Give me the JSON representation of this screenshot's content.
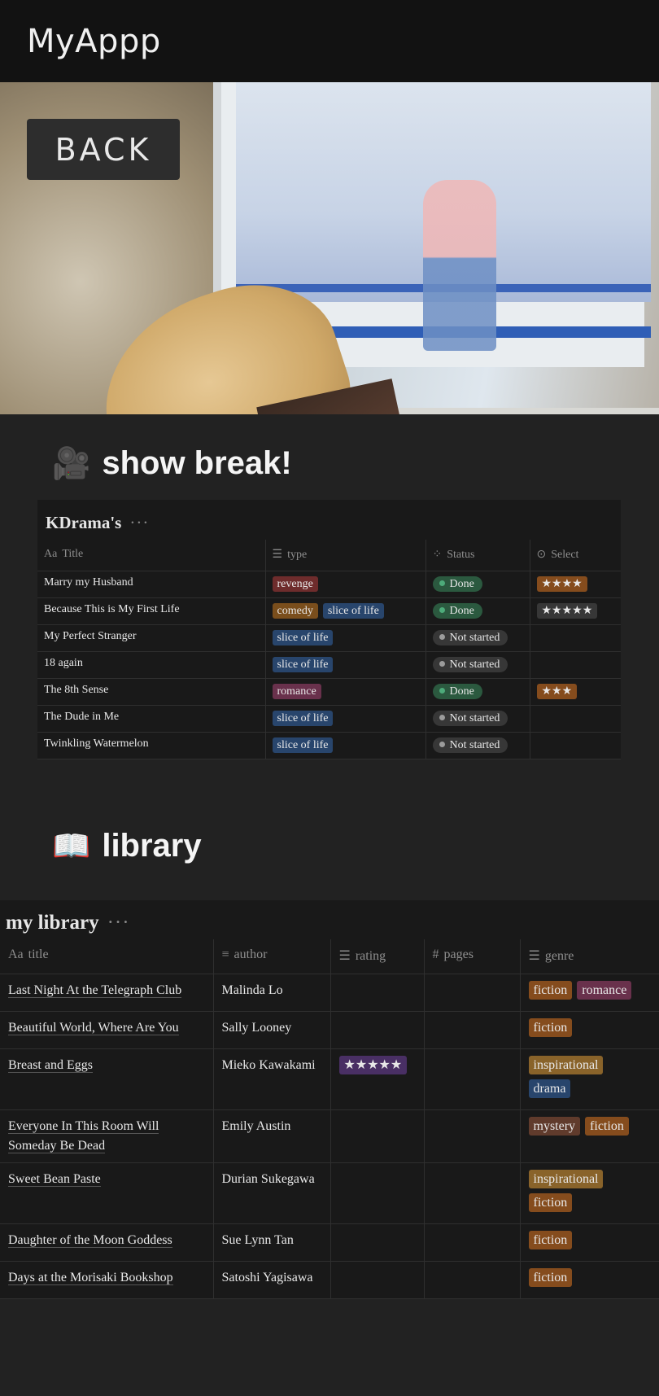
{
  "app": {
    "title": "MyAppp"
  },
  "cover": {
    "back_label": "BACK",
    "page_icon": "jellyfish-icon"
  },
  "kdrama": {
    "heading_emoji": "🎥",
    "heading": "show break!",
    "db_title": "KDrama's",
    "more": "···",
    "columns": {
      "title": "Title",
      "type": "type",
      "status": "Status",
      "select": "Select"
    },
    "column_icons": {
      "title": "Aa",
      "type": "☰",
      "status": "⁘",
      "select": "⊙"
    },
    "rows": [
      {
        "title": "Marry my Husband",
        "types": [
          {
            "label": "revenge",
            "color": "#6e2c2c"
          }
        ],
        "status": "Done",
        "select": "★★★★"
      },
      {
        "title": "Because This is My First Life",
        "types": [
          {
            "label": "comedy",
            "color": "#7a4e1c"
          },
          {
            "label": "slice of life",
            "color": "#28456c"
          }
        ],
        "status": "Done",
        "select": "★★★★★"
      },
      {
        "title": "My Perfect Stranger",
        "types": [
          {
            "label": "slice of life",
            "color": "#28456c"
          }
        ],
        "status": "Not started",
        "select": ""
      },
      {
        "title": "18 again",
        "types": [
          {
            "label": "slice of life",
            "color": "#28456c"
          }
        ],
        "status": "Not started",
        "select": ""
      },
      {
        "title": "The 8th Sense",
        "types": [
          {
            "label": "romance",
            "color": "#69314c"
          }
        ],
        "status": "Done",
        "select": "★★★"
      },
      {
        "title": "The Dude in Me",
        "types": [
          {
            "label": "slice of life",
            "color": "#28456c"
          }
        ],
        "status": "Not started",
        "select": ""
      },
      {
        "title": "Twinkling Watermelon",
        "types": [
          {
            "label": "slice of life",
            "color": "#28456c"
          }
        ],
        "status": "Not started",
        "select": ""
      }
    ],
    "status_colors": {
      "Done": "#2b593f",
      "Not started": "#373737"
    },
    "status_dot_colors": {
      "Done": "#4dab7a",
      "Not started": "#9b9b9b"
    },
    "select_colors": {
      "★★★★": "#854c1d",
      "★★★★★": "#373737",
      "★★★": "#854c1d"
    }
  },
  "library": {
    "heading_emoji": "📖",
    "heading": "library",
    "db_title": "my library",
    "more": "···",
    "columns": {
      "title": "title",
      "author": "author",
      "rating": "rating",
      "pages": "pages",
      "genre": "genre"
    },
    "column_icons": {
      "title": "Aa",
      "author": "≡",
      "rating": "☰",
      "pages": "#",
      "genre": "☰"
    },
    "rows": [
      {
        "title": "Last Night At the Telegraph Club",
        "author": "Malinda Lo",
        "rating": "",
        "pages": "",
        "genres": [
          {
            "label": "fiction",
            "color": "#854c1d"
          },
          {
            "label": "romance",
            "color": "#69314c"
          }
        ]
      },
      {
        "title": "Beautiful World, Where Are You",
        "author": "Sally Looney",
        "rating": "",
        "pages": "",
        "genres": [
          {
            "label": "fiction",
            "color": "#854c1d"
          }
        ]
      },
      {
        "title": "Breast and Eggs",
        "author": "Mieko Kawakami",
        "rating": "★★★★★",
        "pages": "",
        "genres": [
          {
            "label": "inspirational",
            "color": "#89632a"
          },
          {
            "label": "drama",
            "color": "#28456c"
          }
        ]
      },
      {
        "title": "Everyone In This Room Will Someday Be Dead",
        "author": "Emily Austin",
        "rating": "",
        "pages": "",
        "genres": [
          {
            "label": "mystery",
            "color": "#603b2c"
          },
          {
            "label": "fiction",
            "color": "#854c1d"
          }
        ]
      },
      {
        "title": "Sweet Bean Paste",
        "author": "Durian Sukegawa",
        "rating": "",
        "pages": "",
        "genres": [
          {
            "label": "inspirational",
            "color": "#89632a"
          },
          {
            "label": "fiction",
            "color": "#854c1d"
          }
        ]
      },
      {
        "title": "Daughter of the Moon Goddess",
        "author": "Sue Lynn Tan",
        "rating": "",
        "pages": "",
        "genres": [
          {
            "label": "fiction",
            "color": "#854c1d"
          }
        ]
      },
      {
        "title": "Days at the Morisaki Bookshop",
        "author": "Satoshi Yagisawa",
        "rating": "",
        "pages": "",
        "genres": [
          {
            "label": "fiction",
            "color": "#854c1d"
          }
        ]
      }
    ],
    "rating_color": "#492f64"
  }
}
